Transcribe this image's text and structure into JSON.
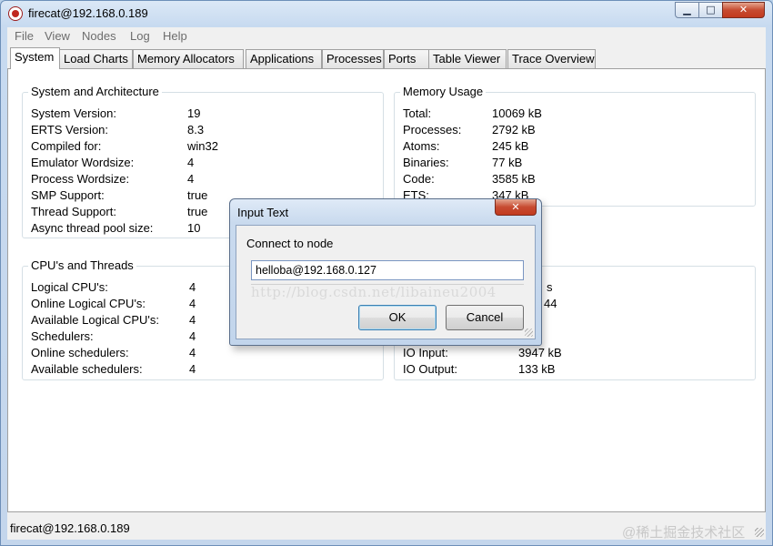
{
  "window": {
    "title": "firecat@192.168.0.189",
    "icon": "erlang-observer-icon",
    "minimize_glyph": "▁",
    "maximize_glyph": "□",
    "close_glyph": "✕"
  },
  "menu": [
    "File",
    "View",
    "Nodes",
    "Log",
    "Help"
  ],
  "tabs": [
    "System",
    "Load Charts",
    "Memory Allocators",
    "Applications",
    "Processes",
    "Ports",
    "Table Viewer",
    "Trace Overview"
  ],
  "active_tab": "System",
  "system": {
    "title": "System and Architecture",
    "rows": [
      {
        "label": "System Version:",
        "value": "19"
      },
      {
        "label": "ERTS Version:",
        "value": "8.3"
      },
      {
        "label": "Compiled for:",
        "value": "win32"
      },
      {
        "label": "Emulator Wordsize:",
        "value": "4"
      },
      {
        "label": "Process Wordsize:",
        "value": "4"
      },
      {
        "label": "SMP Support:",
        "value": "true"
      },
      {
        "label": "Thread Support:",
        "value": "true"
      },
      {
        "label": "Async thread pool size:",
        "value": "10"
      }
    ]
  },
  "memory": {
    "title": "Memory Usage",
    "rows": [
      {
        "label": "Total:",
        "value": "10069 kB"
      },
      {
        "label": "Processes:",
        "value": "2792 kB"
      },
      {
        "label": "Atoms:",
        "value": "245 kB"
      },
      {
        "label": "Binaries:",
        "value": "77 kB"
      },
      {
        "label": "Code:",
        "value": "3585 kB"
      },
      {
        "label": "ETS:",
        "value": "347 kB"
      }
    ]
  },
  "cpu": {
    "title": "CPU's and Threads",
    "rows": [
      {
        "label": "Logical CPU's:",
        "value": "4"
      },
      {
        "label": "Online Logical CPU's:",
        "value": "4"
      },
      {
        "label": "Available Logical CPU's:",
        "value": "4"
      },
      {
        "label": "Schedulers:",
        "value": "4"
      },
      {
        "label": "Online schedulers:",
        "value": "4"
      },
      {
        "label": "Available schedulers:",
        "value": "4"
      }
    ]
  },
  "stats": {
    "partial_top_right_1": "s",
    "partial_top_right_2": "44",
    "rows": [
      {
        "label": "IO Input:",
        "value": "3947 kB"
      },
      {
        "label": "IO Output:",
        "value": "133 kB"
      }
    ]
  },
  "status_bar": "firecat@192.168.0.189",
  "watermark": "@稀土掘金技术社区",
  "dialog": {
    "title": "Input Text",
    "close_glyph": "✕",
    "prompt": "Connect to node",
    "input_value": "helloba@192.168.0.127",
    "overlay_watermark": "http://blog.csdn.net/libaineu2004",
    "ok_label": "OK",
    "cancel_label": "Cancel"
  }
}
